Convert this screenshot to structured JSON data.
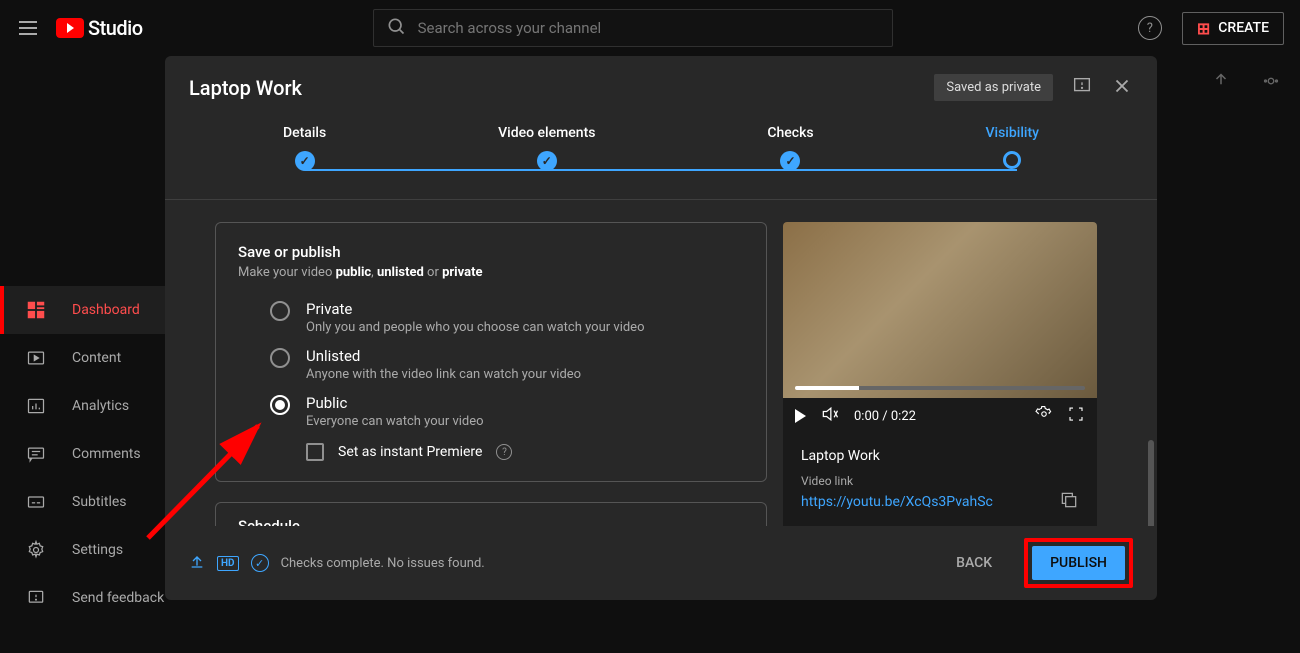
{
  "header": {
    "logo_text": "Studio",
    "search_placeholder": "Search across your channel",
    "create_label": "CREATE"
  },
  "sidebar": {
    "items": [
      {
        "label": "Dashboard",
        "icon": "dashboard",
        "active": true
      },
      {
        "label": "Content",
        "icon": "content"
      },
      {
        "label": "Analytics",
        "icon": "analytics"
      },
      {
        "label": "Comments",
        "icon": "comments"
      },
      {
        "label": "Subtitles",
        "icon": "subtitles"
      },
      {
        "label": "Settings",
        "icon": "settings"
      },
      {
        "label": "Send feedback",
        "icon": "feedback"
      }
    ]
  },
  "modal": {
    "title": "Laptop Work",
    "saved_badge": "Saved as private",
    "steps": [
      "Details",
      "Video elements",
      "Checks",
      "Visibility"
    ],
    "active_step": 3,
    "save_card": {
      "title": "Save or publish",
      "subtitle_prefix": "Make your video ",
      "subtitle_b1": "public",
      "subtitle_sep1": ", ",
      "subtitle_b2": "unlisted",
      "subtitle_sep2": " or ",
      "subtitle_b3": "private",
      "options": [
        {
          "label": "Private",
          "desc": "Only you and people who you choose can watch your video",
          "selected": false
        },
        {
          "label": "Unlisted",
          "desc": "Anyone with the video link can watch your video",
          "selected": false
        },
        {
          "label": "Public",
          "desc": "Everyone can watch your video",
          "selected": true
        }
      ],
      "premiere_label": "Set as instant Premiere"
    },
    "schedule_title": "Schedule",
    "preview": {
      "time": "0:00 / 0:22",
      "video_title": "Laptop Work",
      "link_label": "Video link",
      "video_link": "https://youtu.be/XcQs3PvahSc"
    },
    "footer": {
      "status_text": "Checks complete. No issues found.",
      "back_label": "BACK",
      "publish_label": "PUBLISH"
    }
  }
}
